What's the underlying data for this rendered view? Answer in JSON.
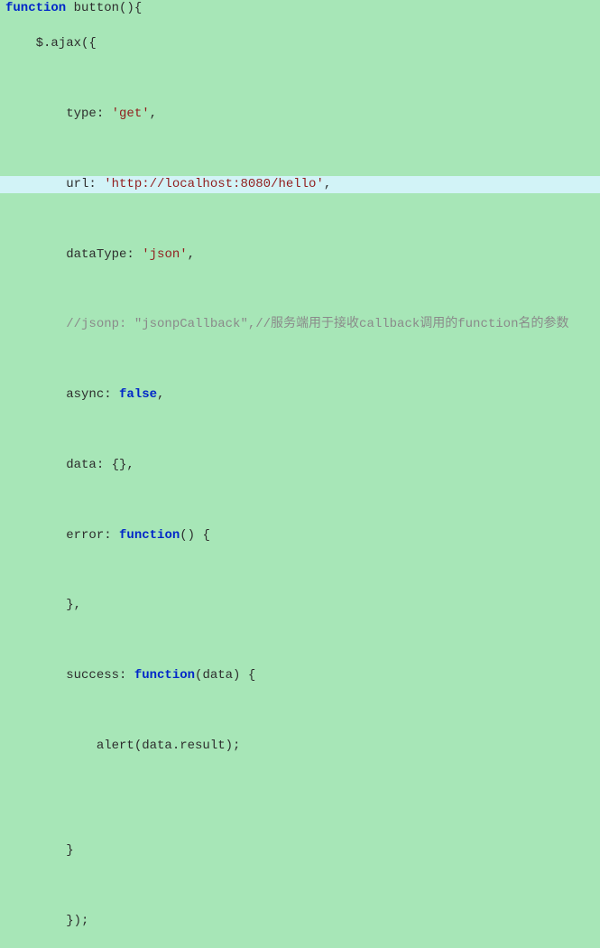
{
  "code": {
    "line1_a": "function",
    "line1_b": " button(){",
    "line2": "    $.ajax({",
    "line4_a": "        type: ",
    "line4_b": "'get'",
    "line4_c": ",",
    "line6_a": "        url: ",
    "line6_b": "'http://localhost:8080/hello'",
    "line6_c": ",",
    "line8_a": "        dataType: ",
    "line8_b": "'json'",
    "line8_c": ",",
    "line10": "        //jsonp: \"jsonpCallback\",//服务端用于接收callback调用的function名的参数",
    "line12_a": "        async: ",
    "line12_b": "false",
    "line12_c": ",",
    "line14": "        data: {},",
    "line16_a": "        error: ",
    "line16_b": "function",
    "line16_c": "() {",
    "line18": "        },",
    "line20_a": "        success: ",
    "line20_b": "function",
    "line20_c": "(data) {",
    "line22": "            alert(data.result);",
    "line25": "        }",
    "line27": "        });"
  }
}
